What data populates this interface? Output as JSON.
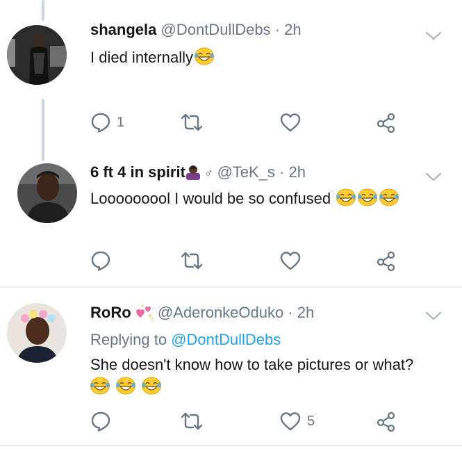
{
  "tweets": [
    {
      "name": "shangela",
      "handle": "@DontDullDebs",
      "time": "2h",
      "text": "I died internally",
      "emoji": [
        "joy-emoji"
      ],
      "actions": {
        "reply_count": "1",
        "retweet_count": "",
        "like_count": ""
      }
    },
    {
      "name": "6 ft 4 in spirit",
      "name_emoji": [
        "woman-shrugging-emoji",
        "male-sign"
      ],
      "handle": "@TeK_s",
      "time": "2h",
      "text": "Looooooool I would be so confused",
      "emoji": [
        "joy-emoji",
        "joy-emoji",
        "joy-emoji"
      ],
      "actions": {
        "reply_count": "",
        "retweet_count": "",
        "like_count": ""
      }
    },
    {
      "name": "RoRo",
      "name_emoji": [
        "sparkling-hearts-emoji"
      ],
      "handle": "@AderonkeOduko",
      "time": "2h",
      "replying_label": "Replying to",
      "replying_to": "@DontDullDebs",
      "text": "She doesn't know how to take pictures or what?",
      "emoji": [
        "joy-emoji",
        "joy-emoji",
        "joy-emoji"
      ],
      "actions": {
        "reply_count": "",
        "retweet_count": "",
        "like_count": "5"
      }
    }
  ],
  "colors": {
    "icon": "#657786",
    "link": "#1da1f2",
    "divider": "#e6ecf0",
    "thread_line": "#ccd6dd"
  }
}
